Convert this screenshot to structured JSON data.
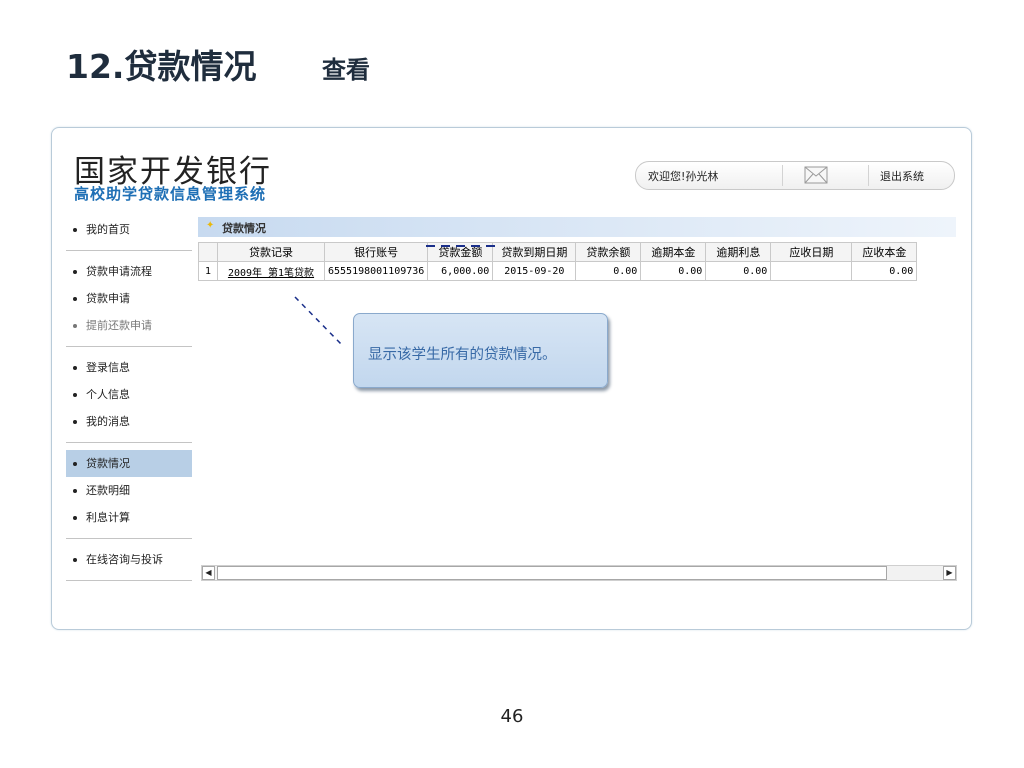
{
  "slide": {
    "title": "12.贷款情况",
    "subtitle": "查看",
    "page_number": "46"
  },
  "app": {
    "brand_main": "国家开发银行",
    "brand_sub": "高校助学贷款信息管理系统",
    "welcome": "欢迎您!孙光林",
    "logout": "退出系统",
    "mail_icon": "mail-icon",
    "accent_color": "#1e6fb5"
  },
  "sidebar": {
    "groups": [
      [
        {
          "label": "我的首页"
        }
      ],
      [
        {
          "label": "贷款申请流程"
        },
        {
          "label": "贷款申请"
        },
        {
          "label": "提前还款申请"
        }
      ],
      [
        {
          "label": "登录信息"
        },
        {
          "label": "个人信息"
        },
        {
          "label": "我的消息"
        }
      ],
      [
        {
          "label": "贷款情况"
        },
        {
          "label": "还款明细"
        },
        {
          "label": "利息计算"
        }
      ],
      [
        {
          "label": "在线咨询与投诉"
        }
      ]
    ],
    "active": "贷款情况"
  },
  "panel": {
    "title": "贷款情况",
    "columns": [
      "",
      "贷款记录",
      "银行账号",
      "贷款金额",
      "贷款到期日期",
      "贷款余额",
      "逾期本金",
      "逾期利息",
      "应收日期",
      "应收本金"
    ],
    "rows": [
      {
        "no": "1",
        "record": "2009年 第1笔贷款",
        "account": "6555198001109736",
        "amount": "6,000.00",
        "due_date": "2015-09-20",
        "balance": "0.00",
        "overdue_principal": "0.00",
        "overdue_interest": "0.00",
        "receivable_date": "",
        "receivable_principal": "0.00"
      }
    ]
  },
  "callout": {
    "text": "显示该学生所有的贷款情况。"
  }
}
